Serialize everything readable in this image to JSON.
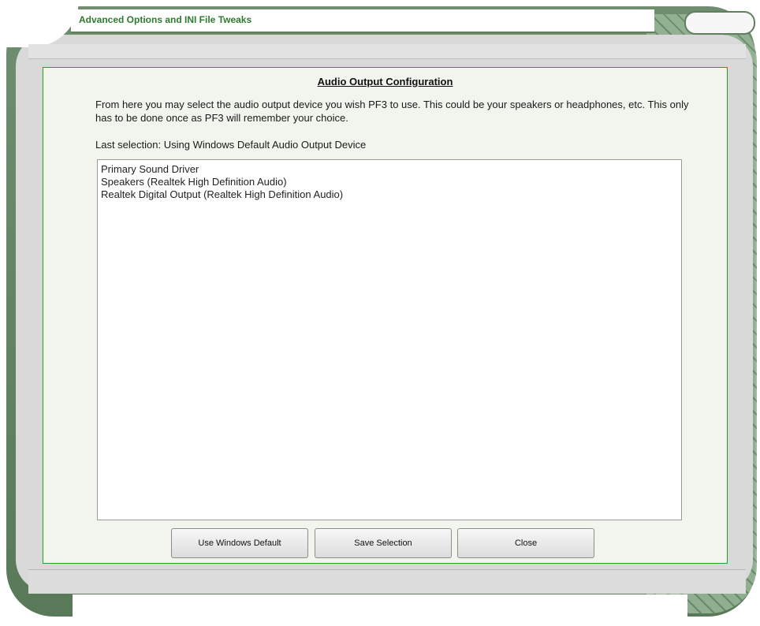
{
  "window": {
    "title": "Advanced Options and INI File Tweaks"
  },
  "panel": {
    "heading": "Audio Output Configuration",
    "description": "From here you may select the audio output device you wish PF3 to use. This could be your speakers or headphones, etc. This only has to be done once as PF3 will remember your choice.",
    "last_selection": "Last selection: Using Windows Default Audio Output Device"
  },
  "devices": [
    "Primary Sound Driver",
    "Speakers (Realtek High Definition Audio)",
    "Realtek Digital Output (Realtek High Definition Audio)"
  ],
  "buttons": {
    "use_default": "Use Windows Default",
    "save": "Save Selection",
    "close": "Close"
  },
  "colors": {
    "accent_green": "#2e7a2e",
    "frame_green": "#5d7d5d",
    "panel_bg": "#f1f5ee"
  }
}
